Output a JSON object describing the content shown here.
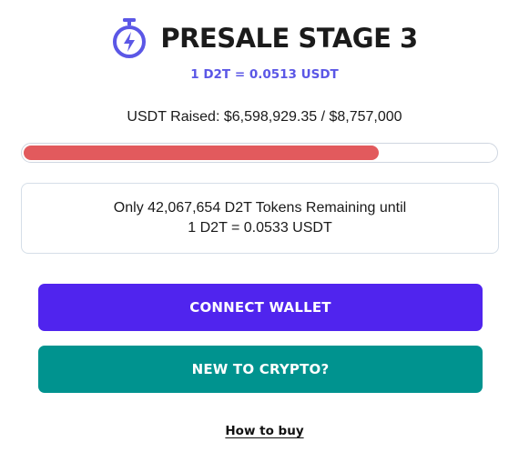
{
  "header": {
    "icon": "stopwatch-icon",
    "title": "PRESALE STAGE 3",
    "rate": "1 D2T = 0.0513 USDT"
  },
  "raised": {
    "text": "USDT Raised: $6,598,929.35 / $8,757,000",
    "progress_fraction": 0.7535
  },
  "notice": {
    "line1": "Only 42,067,654 D2T Tokens Remaining until",
    "line2": "1 D2T = 0.0533 USDT"
  },
  "buttons": {
    "connect_wallet": "CONNECT WALLET",
    "new_to_crypto": "NEW TO CRYPTO?"
  },
  "links": {
    "how_to_buy": "How to buy"
  },
  "colors": {
    "accent": "#5b57e6",
    "progress": "#e25a5d",
    "connect_button": "#5024ee",
    "new_button": "#00938f"
  }
}
